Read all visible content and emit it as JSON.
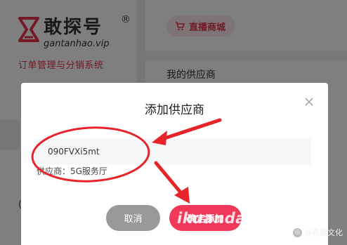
{
  "brand": {
    "name": "敢探号",
    "registered": "®",
    "domain": "gantanhao.vip",
    "system": "订单管理与分销系统",
    "accent": "#e8324b"
  },
  "header": {
    "live_button_label": "直播商城",
    "live_button_icon": "cart-icon"
  },
  "main": {
    "section_title": "我的供应商"
  },
  "sidebar": {
    "fragment": "("
  },
  "modal": {
    "title": "添加供应商",
    "input_value": "090FVXi5mt",
    "supplier_info": "供应商：5G服务厅",
    "cancel_label": "取消",
    "confirm_label": "确定添加",
    "confirm_color": "#f0395a",
    "cancel_color": "#999999"
  },
  "watermark": {
    "text": "ikuandai.cn",
    "corner_text": "@孔蒙文化"
  }
}
